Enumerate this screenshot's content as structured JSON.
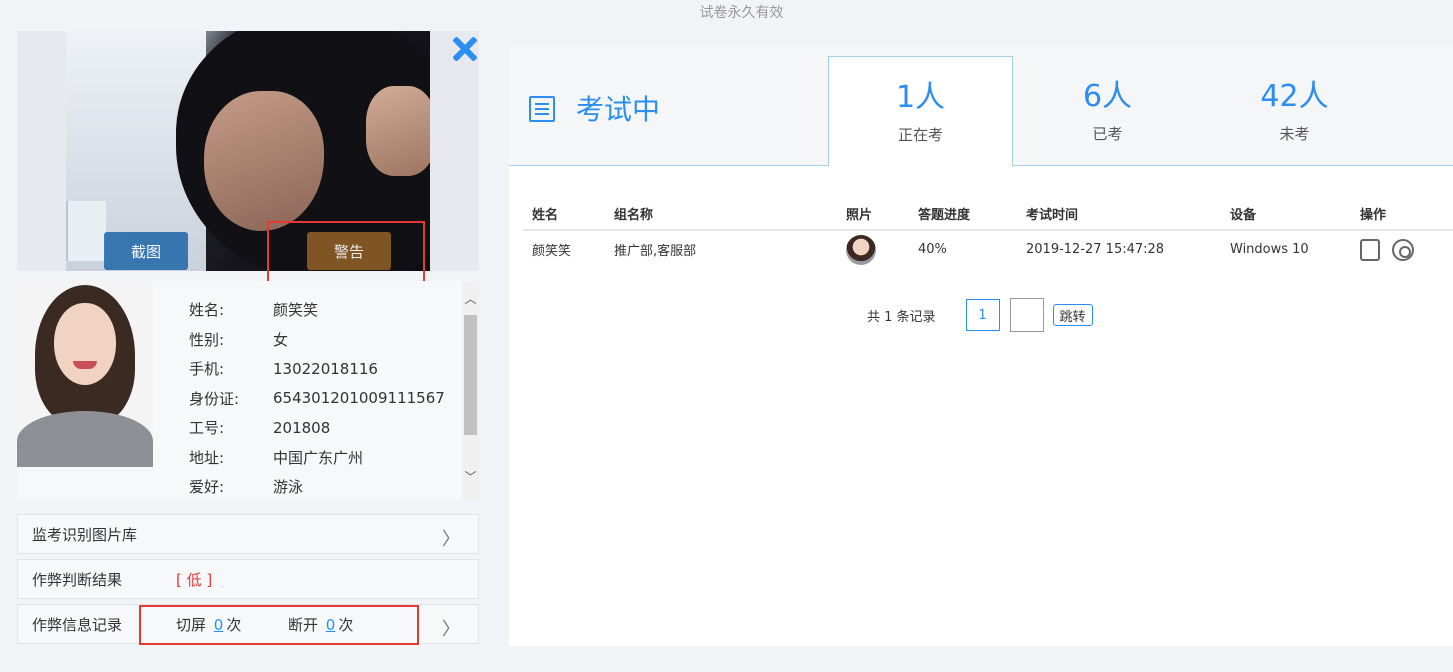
{
  "top_note": "试卷永久有效",
  "video": {
    "capture_label": "截图",
    "warn_label": "警告"
  },
  "profile": {
    "fields": [
      {
        "key": "姓名:",
        "value": "颜笑笑"
      },
      {
        "key": "性别:",
        "value": "女"
      },
      {
        "key": "手机:",
        "value": "13022018116"
      },
      {
        "key": "身份证:",
        "value": "654301201009111567"
      },
      {
        "key": "工号:",
        "value": "201808"
      },
      {
        "key": "地址:",
        "value": "中国广东广州"
      },
      {
        "key": "爱好:",
        "value": "游泳"
      }
    ]
  },
  "bars": {
    "library": "监考识别图片库",
    "judge": "作弊判断结果",
    "judge_result": "[ 低 ]",
    "record": "作弊信息记录",
    "switch_label": "切屏",
    "switch_count": "0",
    "disconnect_label": "断开",
    "disconnect_count": "0",
    "times": "次"
  },
  "right": {
    "title": "考试中",
    "tabs": [
      {
        "count": "1人",
        "label": "正在考"
      },
      {
        "count": "6人",
        "label": "已考"
      },
      {
        "count": "42人",
        "label": "未考"
      }
    ],
    "table": {
      "headers": [
        "姓名",
        "组名称",
        "照片",
        "答题进度",
        "考试时间",
        "设备",
        "操作"
      ],
      "rows": [
        {
          "name": "颜笑笑",
          "group": "推广部,客服部",
          "progress": "40%",
          "time": "2019-12-27 15:47:28",
          "device": "Windows 10"
        }
      ]
    },
    "pager": {
      "count": "共 1 条记录",
      "page": "1",
      "jump": "跳转"
    }
  },
  "colors": {
    "accent": "#2b8ef0",
    "highlight": "#e53935"
  }
}
